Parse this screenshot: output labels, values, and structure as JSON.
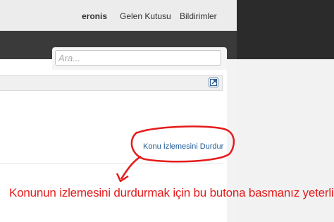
{
  "topnav": {
    "username": "eronis",
    "inbox": "Gelen Kutusu",
    "notifications": "Bildirimler"
  },
  "search": {
    "placeholder": "Ara..."
  },
  "thread": {
    "unwatch_label": "Konu İzlemesini Durdur"
  },
  "annotation": {
    "text": "Konunun izlemesini durdurmak için bu butona basmanız yeterlidir",
    "color": "#e51b1b"
  },
  "colors": {
    "link": "#1f5a94",
    "dark_bar": "#3a3a3a"
  }
}
